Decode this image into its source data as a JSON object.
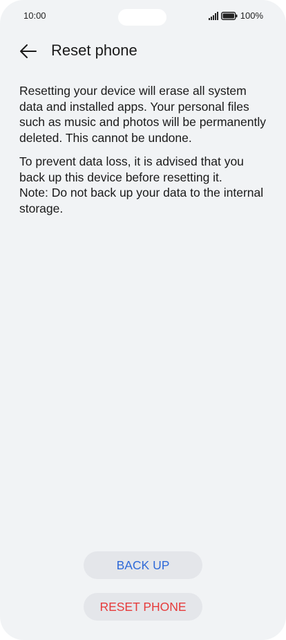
{
  "status_bar": {
    "time": "10:00",
    "battery": "100%"
  },
  "header": {
    "title": "Reset phone",
    "back_icon": "arrow-left-icon"
  },
  "content": {
    "paragraph1": "Resetting your device will erase all system data and installed apps. Your personal files such as music and photos will be permanently deleted. This cannot be undone.",
    "paragraph2": "To prevent data loss, it is advised that you back up this device before resetting it.",
    "note": "Note: Do not back up your data to the internal storage."
  },
  "buttons": {
    "backup_label": "BACK UP",
    "reset_label": "RESET PHONE"
  },
  "colors": {
    "background": "#f1f3f5",
    "backup_text": "#2f6ad8",
    "reset_text": "#e63b3b",
    "button_bg": "#e4e6ea"
  }
}
